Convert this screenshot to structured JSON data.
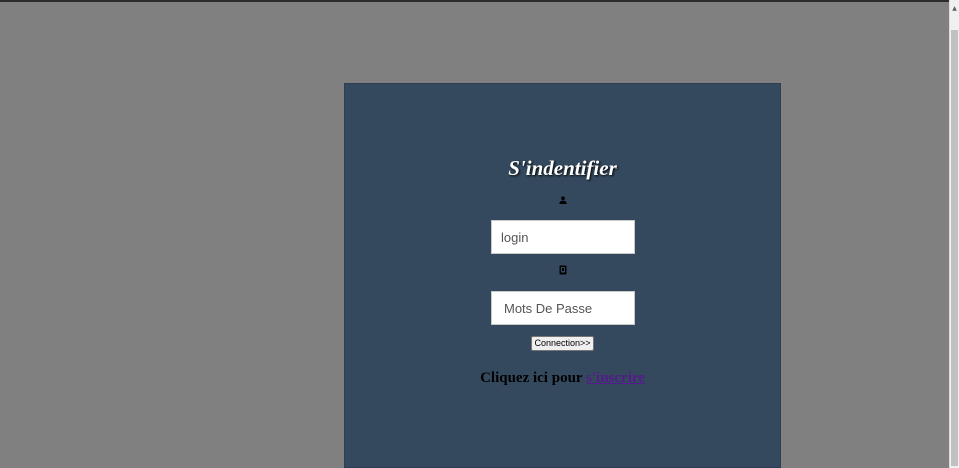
{
  "login_form": {
    "title": "S'indentifier",
    "user_icon": "user-icon",
    "lock_icon": "lock-icon",
    "login_placeholder": "login",
    "password_placeholder": "Mots De Passe",
    "submit_label": "Connection>>",
    "register_prefix": "Cliquez ici pour ",
    "register_link": "s'inscrire"
  },
  "colors": {
    "page_background": "#808080",
    "panel_background": "#34495e",
    "title_color": "#ffffff",
    "link_color": "#551a8b"
  }
}
